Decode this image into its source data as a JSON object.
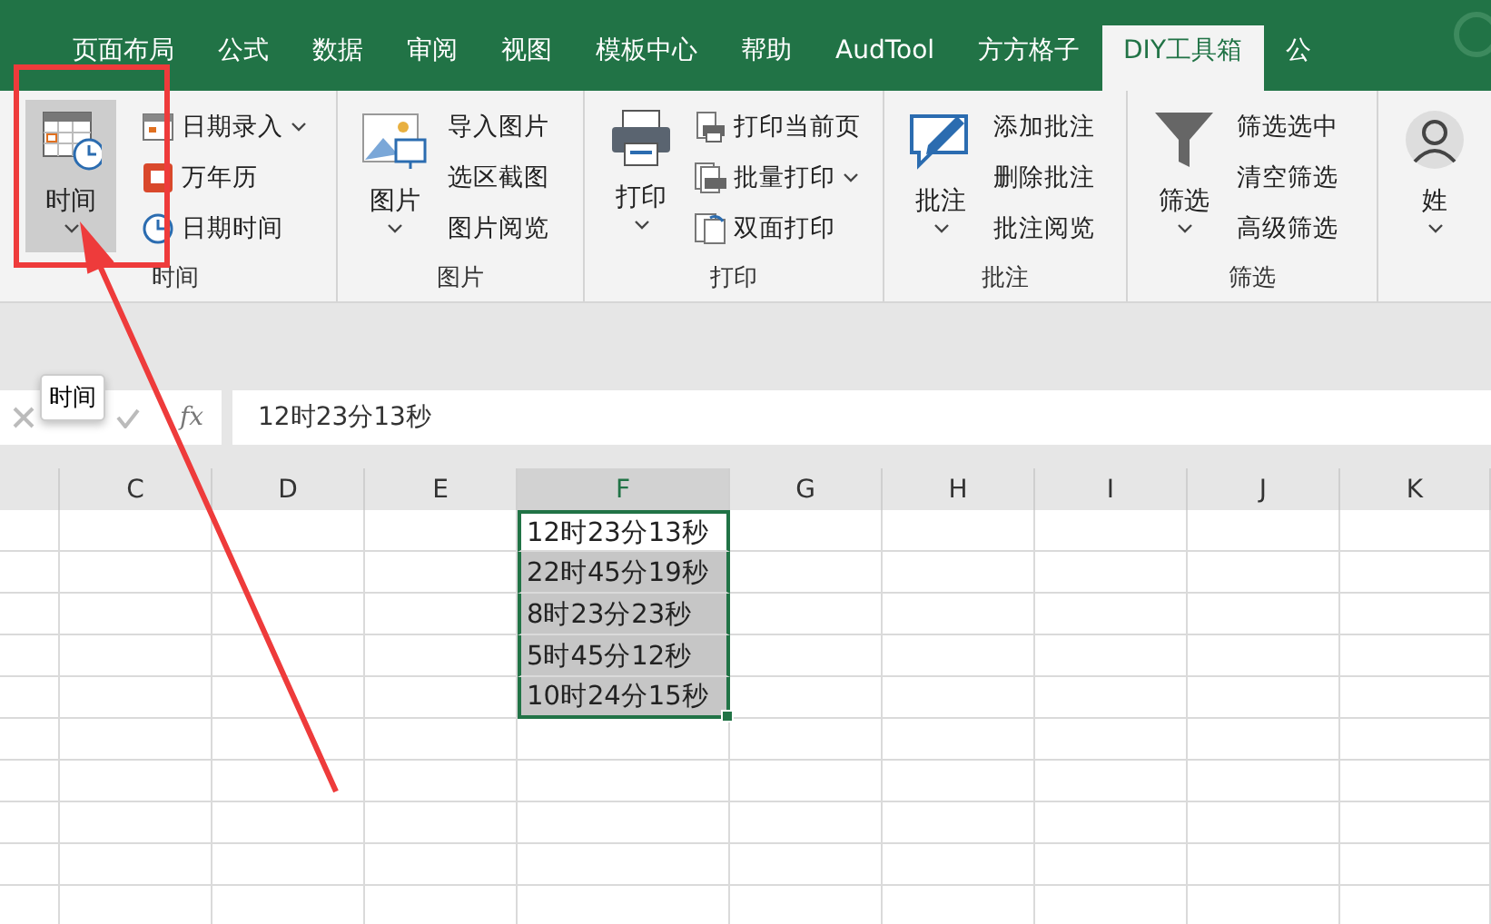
{
  "tabs": [
    {
      "label": "页面布局",
      "selected": false
    },
    {
      "label": "公式",
      "selected": false
    },
    {
      "label": "数据",
      "selected": false
    },
    {
      "label": "审阅",
      "selected": false
    },
    {
      "label": "视图",
      "selected": false
    },
    {
      "label": "模板中心",
      "selected": false
    },
    {
      "label": "帮助",
      "selected": false
    },
    {
      "label": "AudTool",
      "selected": false
    },
    {
      "label": "方方格子",
      "selected": false
    },
    {
      "label": "DIY工具箱",
      "selected": true
    },
    {
      "label": "公",
      "selected": false
    }
  ],
  "ribbon": [
    {
      "label": "时间",
      "large": {
        "label": "时间",
        "dropdown": true,
        "selected": true
      },
      "small": [
        {
          "label": "日期录入",
          "dropdown": true
        },
        {
          "label": "万年历",
          "dropdown": false
        },
        {
          "label": "日期时间",
          "dropdown": false
        }
      ]
    },
    {
      "label": "图片",
      "large": {
        "label": "图片",
        "dropdown": true,
        "selected": false
      },
      "small": [
        {
          "label": "导入图片",
          "dropdown": false
        },
        {
          "label": "选区截图",
          "dropdown": false
        },
        {
          "label": "图片阅览",
          "dropdown": false
        }
      ]
    },
    {
      "label": "打印",
      "large": {
        "label": "打印",
        "dropdown": true,
        "selected": false
      },
      "small": [
        {
          "label": "打印当前页",
          "dropdown": false
        },
        {
          "label": "批量打印",
          "dropdown": true
        },
        {
          "label": "双面打印",
          "dropdown": false
        }
      ]
    },
    {
      "label": "批注",
      "large": {
        "label": "批注",
        "dropdown": true,
        "selected": false
      },
      "small": [
        {
          "label": "添加批注",
          "dropdown": false
        },
        {
          "label": "删除批注",
          "dropdown": false
        },
        {
          "label": "批注阅览",
          "dropdown": false
        }
      ]
    },
    {
      "label": "筛选",
      "large": {
        "label": "筛选",
        "dropdown": true,
        "selected": false
      },
      "small": [
        {
          "label": "筛选选中",
          "dropdown": false
        },
        {
          "label": "清空筛选",
          "dropdown": false
        },
        {
          "label": "高级筛选",
          "dropdown": false
        }
      ]
    },
    {
      "large": {
        "label": "姓",
        "dropdown": true,
        "selected": false
      }
    }
  ],
  "formula_bar": {
    "tooltip": "时间",
    "fx_label": "fx",
    "value": "12时23分13秒"
  },
  "sheet": {
    "columns": [
      {
        "label": "C",
        "selected": false
      },
      {
        "label": "D",
        "selected": false
      },
      {
        "label": "E",
        "selected": false
      },
      {
        "label": "F",
        "selected": true
      },
      {
        "label": "G",
        "selected": false
      },
      {
        "label": "H",
        "selected": false
      },
      {
        "label": "I",
        "selected": false
      },
      {
        "label": "J",
        "selected": false
      },
      {
        "label": "K",
        "selected": false
      }
    ],
    "column_f": [
      {
        "text": "12时23分13秒",
        "selected": true,
        "active": true
      },
      {
        "text": "22时45分19秒",
        "selected": true,
        "active": false
      },
      {
        "text": "8时23分23秒",
        "selected": true,
        "active": false
      },
      {
        "text": "5时45分12秒",
        "selected": true,
        "active": false
      },
      {
        "text": "10时24分15秒",
        "selected": true,
        "active": false
      }
    ]
  }
}
